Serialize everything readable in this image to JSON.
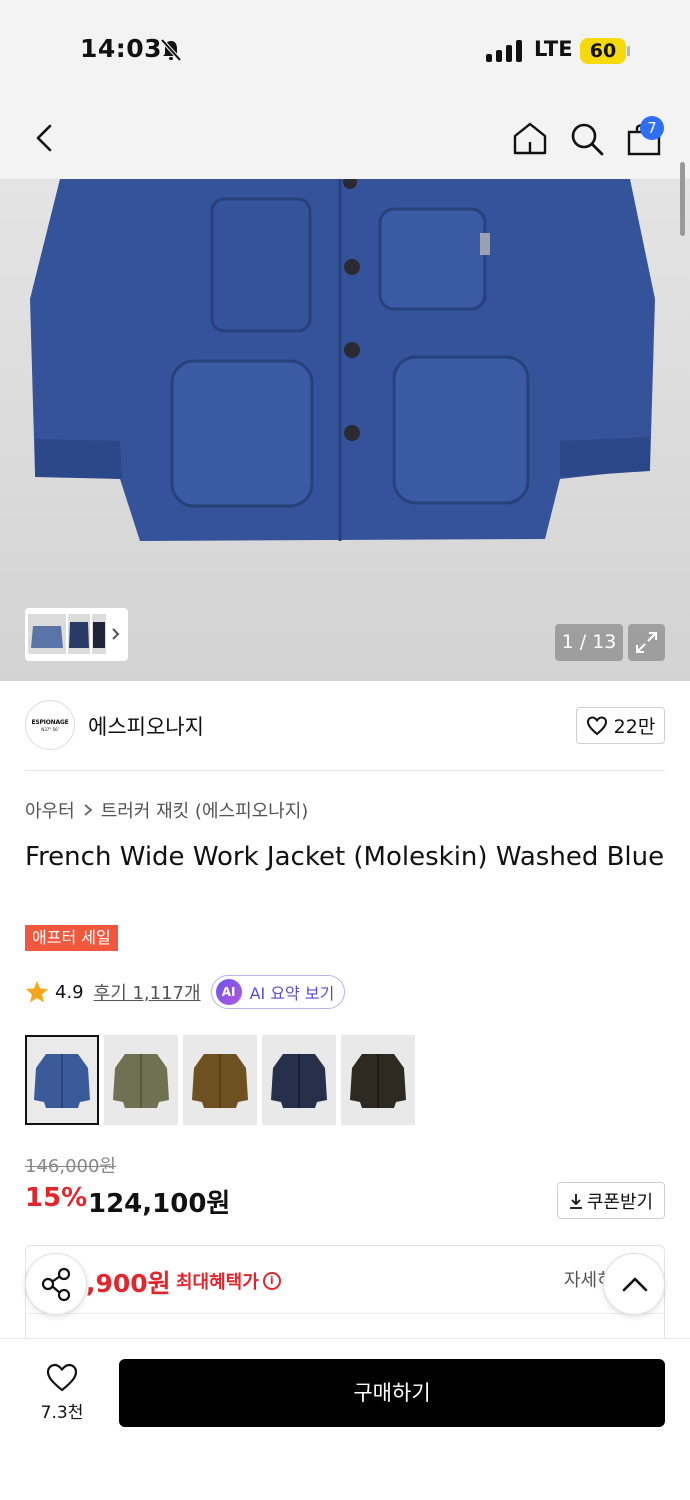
{
  "status_bar": {
    "time": "14:03",
    "network": "LTE",
    "battery": "60"
  },
  "nav": {
    "cart_count": "7"
  },
  "gallery": {
    "page_indicator": "1 / 13"
  },
  "brand": {
    "logo_line1": "ESPIONAGE",
    "logo_line2": "N37° 56'",
    "name": "에스피오나지",
    "like_count": "22만"
  },
  "breadcrumb": {
    "category": "아우터",
    "subcategory": "트러커 재킷 (에스피오나지)"
  },
  "product": {
    "title": "French Wide Work Jacket (Moleskin) Washed Blue",
    "sale_badge": "애프터 세일",
    "rating": "4.9",
    "reviews": "후기 1,117개",
    "ai_icon": "AI",
    "ai_summary": "AI 요약 보기"
  },
  "color_options": [
    {
      "name": "washed-blue",
      "color": "#3a5a9a"
    },
    {
      "name": "olive",
      "color": "#6e7252"
    },
    {
      "name": "brown",
      "color": "#6e5120"
    },
    {
      "name": "navy",
      "color": "#26304a"
    },
    {
      "name": "dark-brown",
      "color": "#2e2a22"
    }
  ],
  "price": {
    "original": "146,000원",
    "discount": "15%",
    "sale": "124,100원",
    "coupon_button": "쿠폰받기"
  },
  "benefit": {
    "max_price": ",900원",
    "label": "최대혜택가",
    "detail": "자세히"
  },
  "bottom_bar": {
    "wish_count": "7.3천",
    "buy_label": "구매하기"
  }
}
